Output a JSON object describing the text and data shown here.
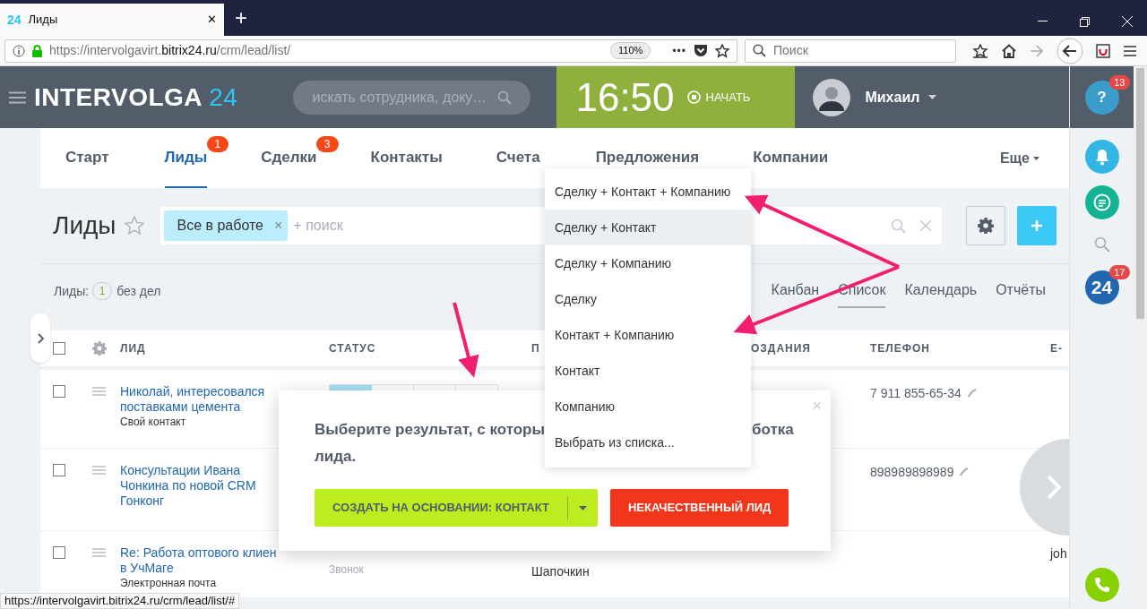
{
  "browser": {
    "tab_logo": "24",
    "tab_title": "Лиды",
    "tab_close": "✕",
    "new_tab": "+",
    "url_prefix": "https://intervolgavirt.",
    "url_domain": "bitrix24.ru",
    "url_path": "/crm/lead/list/",
    "zoom": "110%",
    "menu_dots": "•••",
    "search_placeholder": "Поиск"
  },
  "header": {
    "logo_text": "INTERVOLGA",
    "logo_num": "24",
    "search_placeholder": "искать сотрудника, доку…",
    "time": "16:50",
    "start": "НАЧАТЬ",
    "user": "Михаил"
  },
  "tabs": [
    {
      "label": "Старт",
      "selected": false
    },
    {
      "label": "Лиды",
      "selected": true,
      "badge": "1"
    },
    {
      "label": "Сделки",
      "selected": false,
      "badge": "3"
    },
    {
      "label": "Контакты",
      "selected": false
    },
    {
      "label": "Счета",
      "selected": false
    },
    {
      "label": "Предложения",
      "selected": false
    },
    {
      "label": "Компании",
      "selected": false
    }
  ],
  "more": "Еще",
  "page": {
    "title": "Лиды",
    "filter_tag": "Все в работе",
    "filter_tag_remove": "×",
    "search_placeholder": "+ поиск",
    "counter_label": "Лиды:",
    "counter": "1",
    "counter_suffix": "без дел"
  },
  "views": [
    {
      "label": "Канбан",
      "selected": false
    },
    {
      "label": "Список",
      "selected": true
    },
    {
      "label": "Календарь",
      "selected": false
    },
    {
      "label": "Отчёты",
      "selected": false
    }
  ],
  "table": {
    "select_all_checked": false,
    "columns": [
      "ЛИД",
      "СТАТУС",
      "П",
      "ОЗДАНИЯ",
      "ТЕЛЕФОН",
      "Е-"
    ],
    "rows": [
      {
        "checked": false,
        "title_lines": [
          "Николай, интересовался",
          "поставками цемента"
        ],
        "source": "Свой контакт",
        "status": {
          "level": 0.25
        },
        "phone": "7 911 855-65-34"
      },
      {
        "checked": false,
        "title_lines": [
          "Консультации Ивана",
          "Чонкина по новой CRM",
          "Гонконг"
        ],
        "phone": "898989898989"
      },
      {
        "checked": false,
        "title_lines": [
          "Re: Работа оптового клиен",
          "в УчМаге"
        ],
        "source": "Электронная почта",
        "status_text": "Звонок",
        "responsible": "Шапочкин",
        "email": "joh"
      }
    ]
  },
  "sidebar": {
    "help": "?",
    "help_badge": "13",
    "b24": "24",
    "b24_badge": "17"
  },
  "popup": {
    "line1_left": "Выберите результат, с которы",
    "line1_right": "ботка",
    "line2": "лида.",
    "close": "×",
    "convert_button": "СОЗДАТЬ НА ОСНОВАНИИ: КОНТАКТ",
    "reject_button": "НЕКАЧЕСТВЕННЫЙ ЛИД"
  },
  "dropdown": [
    {
      "label": "Сделку + Контакт + Компанию",
      "selected": false
    },
    {
      "label": "Сделку + Контакт",
      "selected": true
    },
    {
      "label": "Сделку + Компанию",
      "selected": false
    },
    {
      "label": "Сделку",
      "selected": false
    },
    {
      "label": "Контакт + Компанию",
      "selected": false
    },
    {
      "label": "Контакт",
      "selected": false
    },
    {
      "label": "Компанию",
      "selected": false
    },
    {
      "label": "Выбрать из списка...",
      "selected": false
    }
  ],
  "status_link": "https://intervolgavirt.bitrix24.ru/crm/lead/list/#"
}
